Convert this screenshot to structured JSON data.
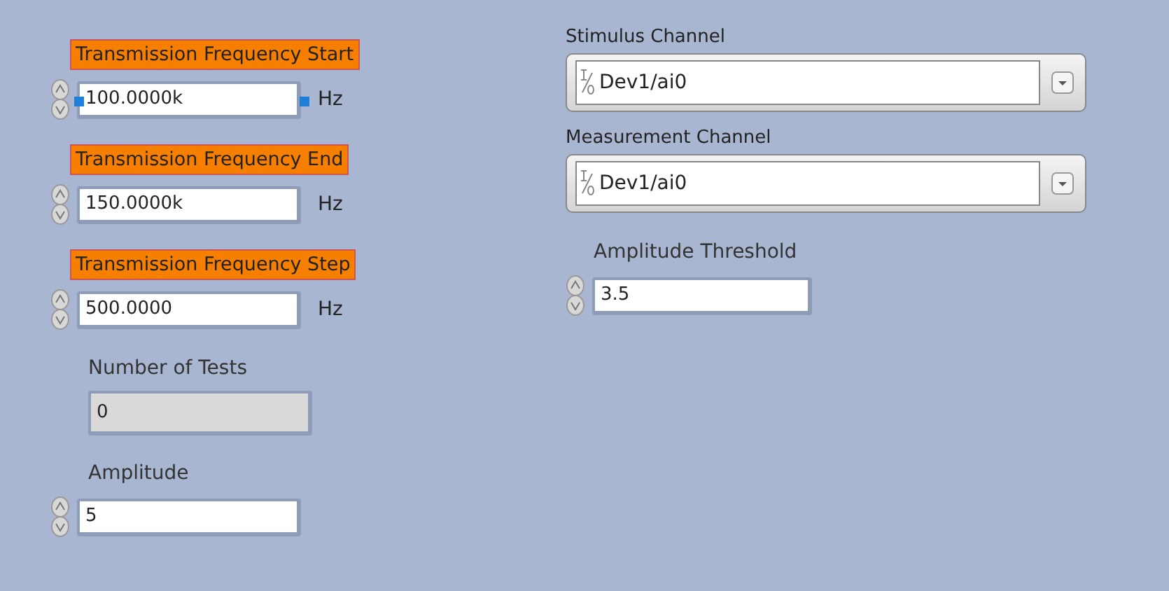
{
  "left_controls": [
    {
      "kind": "control",
      "label": "Transmission Frequency Start",
      "highlighted": true,
      "selected": true,
      "value": "100.0000k",
      "unit": "Hz"
    },
    {
      "kind": "control",
      "label": "Transmission Frequency End",
      "highlighted": true,
      "selected": false,
      "value": "150.0000k",
      "unit": "Hz"
    },
    {
      "kind": "control",
      "label": "Transmission Frequency Step",
      "highlighted": true,
      "selected": false,
      "value": "500.0000",
      "unit": "Hz"
    },
    {
      "kind": "indicator",
      "label": "Number of Tests",
      "highlighted": false,
      "selected": false,
      "value": "0"
    },
    {
      "kind": "control",
      "label": "Amplitude",
      "highlighted": false,
      "selected": false,
      "value": "5"
    }
  ],
  "channels": [
    {
      "label": "Stimulus Channel",
      "value": "Dev1/ai0"
    },
    {
      "label": "Measurement Channel",
      "value": "Dev1/ai0"
    }
  ],
  "threshold": {
    "kind": "control",
    "label": "Amplitude Threshold",
    "value": "3.5"
  }
}
